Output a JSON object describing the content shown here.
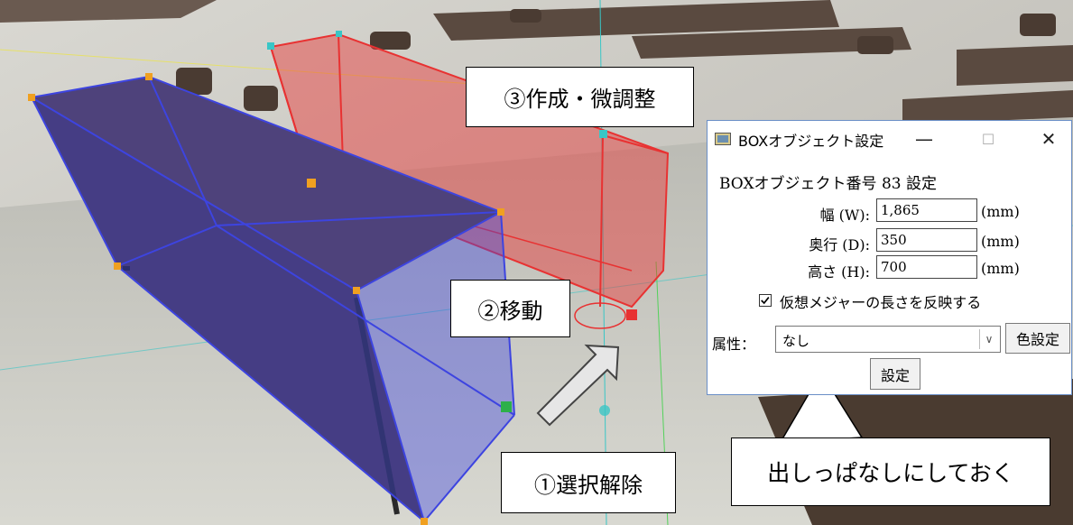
{
  "annotations": {
    "step1": "①選択解除",
    "step2": "②移動",
    "step3": "③作成・微調整",
    "keep_open": "出しっぱなしにしておく"
  },
  "dialog": {
    "title": "BOXオブジェクト設定",
    "minimize_glyph": "—",
    "maximize_glyph": "☐",
    "close_glyph": "✕",
    "heading": "BOXオブジェクト番号 83 設定",
    "fields": {
      "width": {
        "label": "幅 (W):",
        "value": "1,865",
        "unit": "(mm)"
      },
      "depth": {
        "label": "奥行 (D):",
        "value": "350",
        "unit": "(mm)"
      },
      "height": {
        "label": "高さ (H):",
        "value": "700",
        "unit": "(mm)"
      }
    },
    "checkbox": {
      "checked": true,
      "mark": "✓",
      "label": "仮想メジャーの長さを反映する"
    },
    "attribute": {
      "label": "属性：",
      "value": "なし",
      "arrow": "∨"
    },
    "color_button": "色設定",
    "ok_button": "設定"
  },
  "colors": {
    "blue_box": "#3d44e0",
    "red_box": "#e83232",
    "dialog_border": "#6a8fc7"
  }
}
